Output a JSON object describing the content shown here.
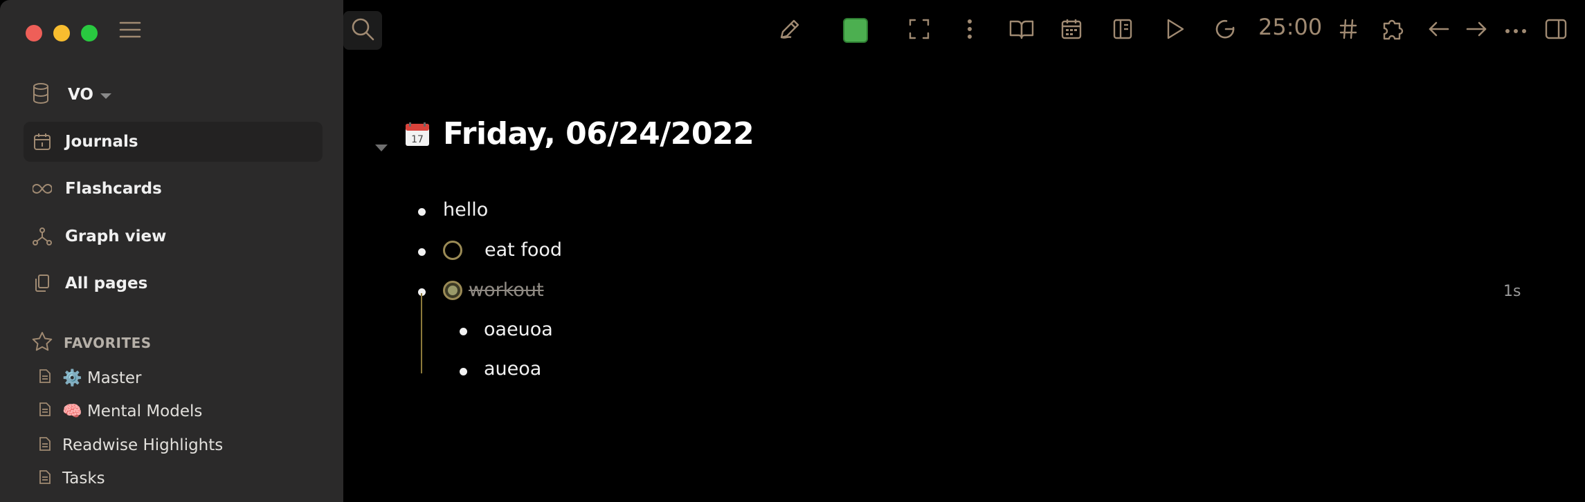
{
  "sidebar": {
    "repo": {
      "name": "VO"
    },
    "nav": [
      {
        "label": "Journals",
        "icon": "calendar-icon",
        "active": true
      },
      {
        "label": "Flashcards",
        "icon": "infinity-icon",
        "active": false
      },
      {
        "label": "Graph view",
        "icon": "graph-icon",
        "active": false
      },
      {
        "label": "All pages",
        "icon": "pages-icon",
        "active": false
      }
    ],
    "favorites": {
      "heading": "FAVORITES",
      "items": [
        {
          "label": "⚙️ Master"
        },
        {
          "label": "🧠 Mental Models"
        },
        {
          "label": "Readwise Highlights"
        },
        {
          "label": "Tasks"
        }
      ]
    }
  },
  "toolbar": {
    "timer": "25:00",
    "swatch_color": "#4caf50",
    "icons": [
      "search-icon",
      "pencil-icon",
      "color-swatch",
      "fullscreen-icon",
      "more-vertical-icon",
      "book-open-icon",
      "calendar-icon",
      "notebook-icon",
      "play-icon",
      "refresh-icon",
      "hash-icon",
      "puzzle-icon",
      "arrow-left-icon",
      "arrow-right-icon",
      "more-horizontal-icon",
      "sidebar-toggle-icon"
    ]
  },
  "page": {
    "title": "Friday, 06/24/2022",
    "blocks": [
      {
        "text": "hello",
        "type": "plain"
      },
      {
        "text": "eat food",
        "type": "todo"
      },
      {
        "text": "workout",
        "type": "done",
        "elapsed": "1s",
        "children": [
          {
            "text": "oaeuoa"
          },
          {
            "text": "aueoa"
          }
        ]
      }
    ]
  },
  "colors": {
    "accent": "#a08a72",
    "sidebar_bg": "#2b2a2a",
    "main_bg": "#000000"
  }
}
